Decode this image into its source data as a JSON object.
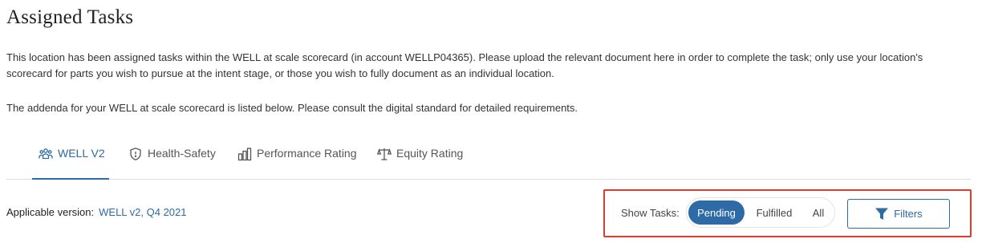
{
  "page": {
    "title": "Assigned Tasks",
    "paragraph1": "This location has been assigned tasks within the WELL at scale scorecard (in account WELLP04365). Please upload the relevant document here in order to complete the task; only use your location's scorecard for parts you wish to pursue at the intent stage, or those you wish to fully document as an individual location.",
    "paragraph2": "The addenda for your WELL at scale scorecard is listed below. Please consult the digital standard for detailed requirements."
  },
  "tabs": [
    {
      "label": "WELL V2",
      "icon": "people-group-icon",
      "active": true
    },
    {
      "label": "Health-Safety",
      "icon": "shield-icon",
      "active": false
    },
    {
      "label": "Performance Rating",
      "icon": "bar-chart-icon",
      "active": false
    },
    {
      "label": "Equity Rating",
      "icon": "scales-icon",
      "active": false
    }
  ],
  "applicable_version": {
    "label": "Applicable version:",
    "value": "WELL v2, Q4 2021"
  },
  "show_tasks": {
    "label": "Show Tasks:",
    "options": [
      "Pending",
      "Fulfilled",
      "All"
    ],
    "selected": "Pending"
  },
  "filters": {
    "label": "Filters",
    "icon": "funnel-icon"
  },
  "colors": {
    "accent": "#2e6aa6",
    "highlight_border": "#e03a2f"
  }
}
